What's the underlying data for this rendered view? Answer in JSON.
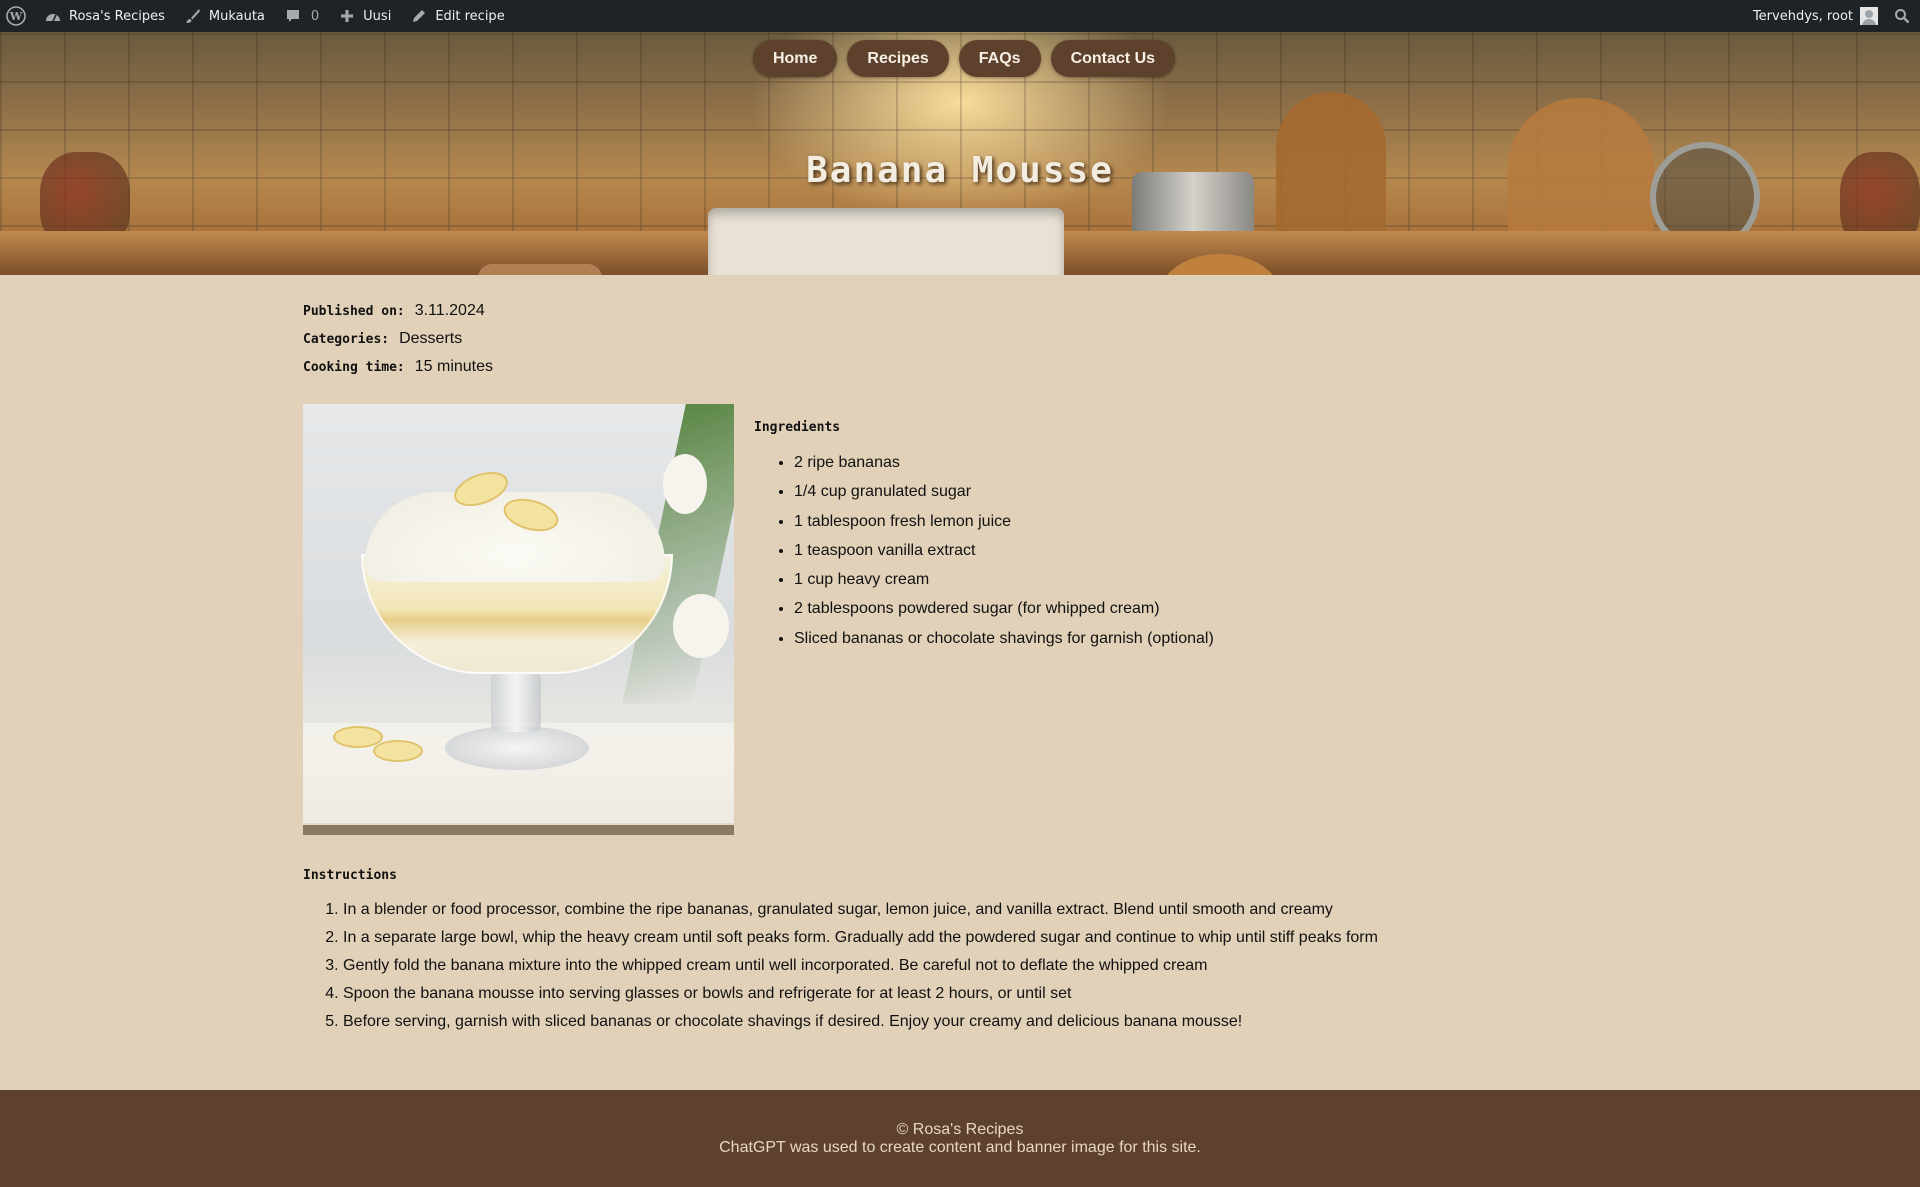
{
  "adminbar": {
    "site_name": "Rosa's Recipes",
    "customize": "Mukauta",
    "comments_count": "0",
    "new": "Uusi",
    "edit": "Edit recipe",
    "greeting": "Tervehdys, root"
  },
  "nav": {
    "items": [
      {
        "label": "Home"
      },
      {
        "label": "Recipes"
      },
      {
        "label": "FAQs"
      },
      {
        "label": "Contact Us"
      }
    ]
  },
  "page": {
    "title": "Banana Mousse"
  },
  "meta": {
    "published_label": "Published on:",
    "published_value": "3.11.2024",
    "categories_label": "Categories:",
    "categories_value": "Desserts",
    "cooking_label": "Cooking time:",
    "cooking_value": "15 minutes"
  },
  "ingredients": {
    "title": "Ingredients",
    "items": [
      "2 ripe bananas",
      "1/4 cup granulated sugar",
      "1 tablespoon fresh lemon juice",
      "1 teaspoon vanilla extract",
      "1 cup heavy cream",
      "2 tablespoons powdered sugar (for whipped cream)",
      "Sliced bananas or chocolate shavings for garnish (optional)"
    ]
  },
  "instructions": {
    "title": "Instructions",
    "steps": [
      "In a blender or food processor, combine the ripe bananas, granulated sugar, lemon juice, and vanilla extract. Blend until smooth and creamy",
      "In a separate large bowl, whip the heavy cream until soft peaks form. Gradually add the powdered sugar and continue to whip until stiff peaks form",
      "Gently fold the banana mixture into the whipped cream until well incorporated. Be careful not to deflate the whipped cream",
      "Spoon the banana mousse into serving glasses or bowls and refrigerate for at least 2 hours, or until set",
      "Before serving, garnish with sliced bananas or chocolate shavings if desired. Enjoy your creamy and delicious banana mousse!"
    ]
  },
  "footer": {
    "copyright": "© Rosa's Recipes",
    "note": "ChatGPT was used to create content and banner image for this site."
  },
  "colors": {
    "adminbar_bg": "#1d2327",
    "page_bg": "#e1d1b8",
    "nav_button_bg": "#5e412c",
    "footer_bg": "#5e412c"
  },
  "icons": [
    "wordpress-icon",
    "dashboard-icon",
    "brush-icon",
    "comment-icon",
    "plus-icon",
    "pencil-icon",
    "avatar-icon",
    "search-icon"
  ]
}
